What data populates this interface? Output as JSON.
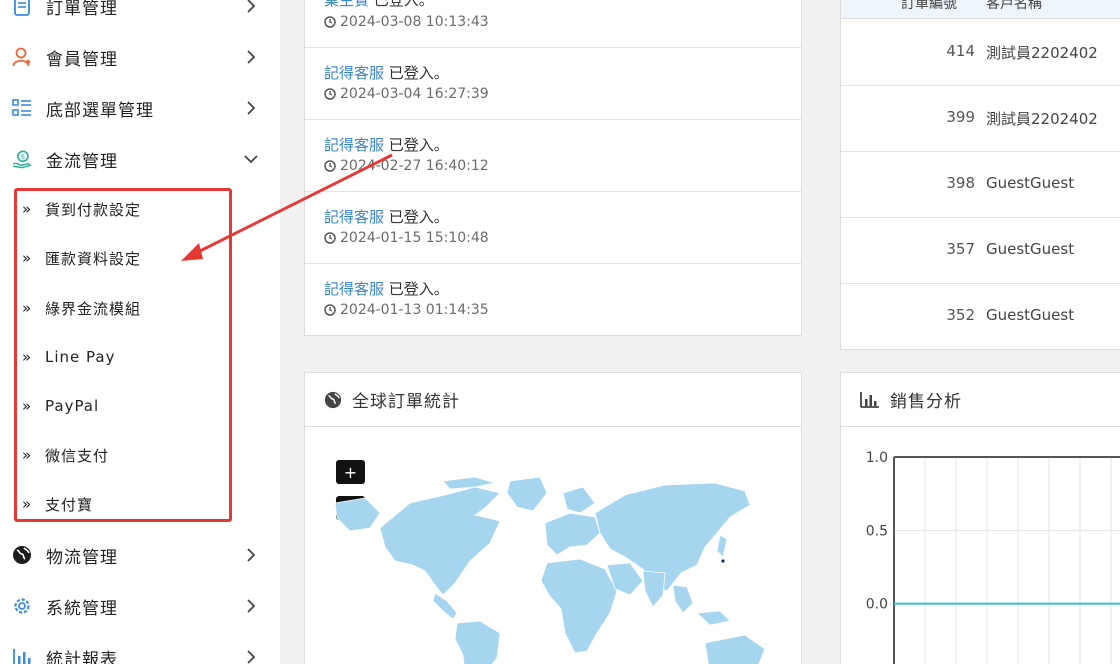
{
  "sidebar": {
    "items": [
      {
        "label": "訂單管理",
        "icon": "document-icon"
      },
      {
        "label": "會員管理",
        "icon": "user-icon"
      },
      {
        "label": "底部選單管理",
        "icon": "list-icon"
      },
      {
        "label": "金流管理",
        "icon": "money-hand-icon"
      },
      {
        "label": "物流管理",
        "icon": "globe-icon"
      },
      {
        "label": "系統管理",
        "icon": "gear-icon"
      },
      {
        "label": "統計報表",
        "icon": "bar-chart-icon"
      }
    ],
    "payment_submenu": [
      {
        "label": "貨到付款設定"
      },
      {
        "label": "匯款資料設定"
      },
      {
        "label": "綠界金流模組"
      },
      {
        "label": "Line Pay"
      },
      {
        "label": "PayPal"
      },
      {
        "label": "微信支付"
      },
      {
        "label": "支付寶"
      }
    ],
    "raquo": "»"
  },
  "activity": {
    "rows": [
      {
        "who": "業主實",
        "action": " 已登入。",
        "time": "2024-03-08 10:13:43"
      },
      {
        "who": "記得客服",
        "action": " 已登入。",
        "time": "2024-03-04 16:27:39"
      },
      {
        "who": "記得客服",
        "action": " 已登入。",
        "time": "2024-02-27 16:40:12"
      },
      {
        "who": "記得客服",
        "action": " 已登入。",
        "time": "2024-01-15 15:10:48"
      },
      {
        "who": "記得客服",
        "action": " 已登入。",
        "time": "2024-01-13 01:14:35"
      }
    ]
  },
  "orders": {
    "header": [
      "訂單編號",
      "客戶名稱"
    ],
    "rows": [
      {
        "id": "414",
        "customer": "測試員2202402"
      },
      {
        "id": "399",
        "customer": "測試員2202402"
      },
      {
        "id": "398",
        "customer": "GuestGuest"
      },
      {
        "id": "357",
        "customer": "GuestGuest"
      },
      {
        "id": "352",
        "customer": "GuestGuest"
      }
    ]
  },
  "map_panel": {
    "title": "全球訂單統計",
    "zoom_in": "+",
    "zoom_out": "−"
  },
  "sales_panel": {
    "title": "銷售分析"
  },
  "chart_data": {
    "type": "line",
    "title": "",
    "xlabel": "",
    "ylabel": "",
    "ylim": [
      -0.5,
      1.0
    ],
    "yticks": [
      "1.0",
      "0.5",
      "0.0"
    ],
    "series": [
      {
        "values": [
          0,
          0,
          0,
          0,
          0,
          0,
          0,
          0,
          0,
          0
        ]
      }
    ],
    "grid": true
  },
  "colors": {
    "accent_link": "#3a87c8",
    "highlight": "#e53935",
    "map_land": "#a6d5ef",
    "line_series": "#3bbcd0"
  }
}
